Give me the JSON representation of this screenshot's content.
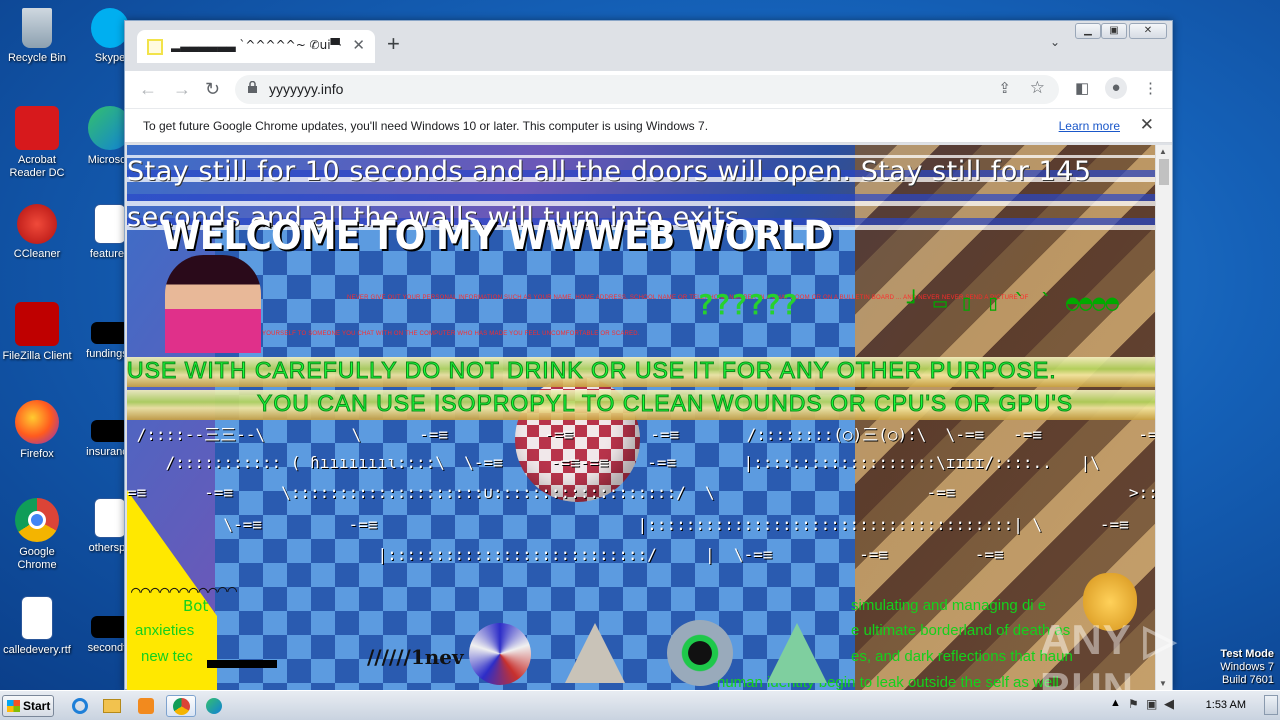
{
  "desktop": {
    "icons": [
      {
        "label": "Recycle Bin"
      },
      {
        "label": "Skype"
      },
      {
        "label": "Acrobat Reader DC"
      },
      {
        "label": "Microsoft"
      },
      {
        "label": "CCleaner"
      },
      {
        "label": "featured"
      },
      {
        "label": "FileZilla Client"
      },
      {
        "label": "fundingse"
      },
      {
        "label": "Firefox"
      },
      {
        "label": "insurance"
      },
      {
        "label": "Google Chrome"
      },
      {
        "label": "otherspo"
      },
      {
        "label": "calledevery.rtf"
      },
      {
        "label": "secondto"
      }
    ]
  },
  "browser": {
    "tab_title": "▂▃▃▃▃▃▃ `^^^^^~ ✆ui▀┐",
    "url": "yyyyyyy.info",
    "infobar_message": "To get future Google Chrome updates, you'll need Windows 10 or later. This computer is using Windows 7.",
    "learn_more": "Learn more"
  },
  "page": {
    "stay_text": "Stay still for 10 seconds and all the doors will open. Stay still for 145 seconds and all the walls will turn into exits.",
    "welcome": "WELCOME TO MY WWWEB WORLD",
    "warning_line1": "NEVER GIVE OUT YOUR PERSONAL INFORMATION SUCH AS YOUR NAME, HOME ADDRESS, SCHOOL NAME OR TELEPHONE NUMBER IN A CHAT ROOM OR ON A BULLETIN BOARD ... AND NEVER NEVER SEND A PICTURE OF",
    "warning_line2": "YOURSELF TO SOMEONE YOU CHAT WITH ON THE COMPUTER WHO HAS MADE YOU FEEL UNCOMFORTABLE OR SCARED.",
    "qmarks": "??????",
    "green_symbols": "┘  ▭ ▯ ▯ ` ` ◓◓◓◓",
    "use_line1": "USE WITH CAREFULLY DO NOT DRINK OR USE IT FOR ANY OTHER PURPOSE.",
    "use_line2": "YOU CAN USE ISOPROPYL TO CLEAN WOUNDS OR CPU'S OR GPU'S",
    "ascii1": " /::::--三三--\\         \\      -=≡          -=≡        -=≡       /::::::::(○)三(○):\\  \\-=≡   -=≡          -=≡",
    "ascii2": "    /::::::::::: ( ɦıııııııɩ::::\\  \\-=≡     -=≡-=≡    -=≡       |:::::::::::::::::::\\ɪɪɪɪ/::::..   |\\       -=≡          -",
    "ascii3": "=≡      -=≡     \\::::::::::::::::::::∪:::::::::::::::::::/  \\                      -=≡                  >::::::::::::::::::::::::::::::::<",
    "ascii4": "          \\-=≡         -=≡                           |::::::::::::::::::::::::::::::::::::::| \\      -=≡          -=≡          -=≡",
    "ascii5": "                          |:::::::::::::::::::::::::::/     |  \\-=≡         -=≡         -=≡                 |::::::::::::::::::::::/ |  |",
    "tilde_row": "⌒⌒⌒⌒⌒⌒⌒⌒⌒◠◠",
    "green_left1": "Bot",
    "green_left2": "anxieties",
    "green_left3": "new tec",
    "green_right1": "simulating and managing di      e",
    "green_right2": "e ultimate borderland of death     as",
    "green_right3": "es, and dark reflections that haun",
    "green_right4": "human identity begin to leak outside the self as well",
    "slashes": "//////1nev"
  },
  "watermark": "ANY ▷ RUN",
  "testmode": {
    "line1": "Test Mode",
    "line2": "Windows 7",
    "line3": "Build 7601"
  },
  "taskbar": {
    "start": "Start",
    "clock": "1:53 AM"
  },
  "colors": {
    "desktop_blue": "#1561b8",
    "neon_green": "#1bff3b",
    "warning_red": "#ff2a2a"
  }
}
